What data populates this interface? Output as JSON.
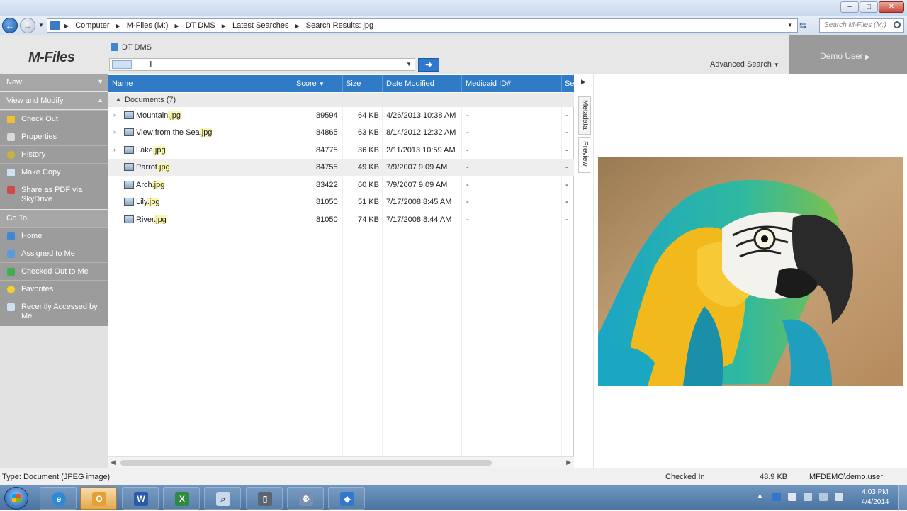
{
  "address": {
    "breadcrumb": [
      "Computer",
      "M-Files (M:)",
      "DT DMS",
      "Latest Searches",
      "Search Results: jpg"
    ],
    "search_placeholder": "Search M-Files (M:)"
  },
  "header": {
    "logo": "M-Files",
    "vault": "DT DMS",
    "search_value": "",
    "advanced_search": "Advanced Search",
    "user": "Demo User"
  },
  "taskpane": {
    "new_label": "New",
    "view_modify_label": "View and Modify",
    "view_modify_items": [
      "Check Out",
      "Properties",
      "History",
      "Make Copy",
      "Share as PDF via SkyDrive"
    ],
    "goto_label": "Go To",
    "goto_items": [
      "Home",
      "Assigned to Me",
      "Checked Out to Me",
      "Favorites",
      "Recently Accessed by Me"
    ]
  },
  "list": {
    "columns": [
      "Name",
      "Score",
      "Size",
      "Date Modified",
      "Medicaid ID#",
      "Se"
    ],
    "group": "Documents (7)",
    "rows": [
      {
        "stem": "Mountain",
        "ext": ".jpg",
        "score": "89594",
        "size": "64 KB",
        "date": "4/26/2013 10:38 AM",
        "medicaid": "-",
        "extra": "-"
      },
      {
        "stem": "View from the Sea",
        "ext": ".jpg",
        "score": "84865",
        "size": "63 KB",
        "date": "8/14/2012 12:32 AM",
        "medicaid": "-",
        "extra": "-"
      },
      {
        "stem": "Lake",
        "ext": ".jpg",
        "score": "84775",
        "size": "36 KB",
        "date": "2/11/2013 10:59 AM",
        "medicaid": "-",
        "extra": "-"
      },
      {
        "stem": "Parrot",
        "ext": ".jpg",
        "score": "84755",
        "size": "49 KB",
        "date": "7/9/2007 9:09 AM",
        "medicaid": "-",
        "extra": "-"
      },
      {
        "stem": "Arch",
        "ext": ".jpg",
        "score": "83422",
        "size": "60 KB",
        "date": "7/9/2007 9:09 AM",
        "medicaid": "-",
        "extra": "-"
      },
      {
        "stem": "Lily",
        "ext": ".jpg",
        "score": "81050",
        "size": "51 KB",
        "date": "7/17/2008 8:45 AM",
        "medicaid": "-",
        "extra": "-"
      },
      {
        "stem": "River",
        "ext": ".jpg",
        "score": "81050",
        "size": "74 KB",
        "date": "7/17/2008 8:44 AM",
        "medicaid": "-",
        "extra": "-"
      }
    ]
  },
  "sidetabs": {
    "metadata": "Metadata",
    "preview": "Preview"
  },
  "statusbar": {
    "type": "Type: Document (JPEG image)",
    "state": "Checked In",
    "size": "48.9 KB",
    "user": "MFDEMO\\demo.user"
  },
  "taskbar": {
    "apps": [
      "internet-explorer-icon",
      "outlook-icon",
      "word-icon",
      "excel-icon",
      "search-app-icon",
      "tablet-icon",
      "mfiles-config-icon",
      "mfiles-app-icon"
    ],
    "time": "4:03 PM",
    "date": "4/4/2014"
  },
  "colors": {
    "accent": "#2f7bc6",
    "taskpane": "#9c9c9c",
    "highlight": "#fbf7b0"
  }
}
